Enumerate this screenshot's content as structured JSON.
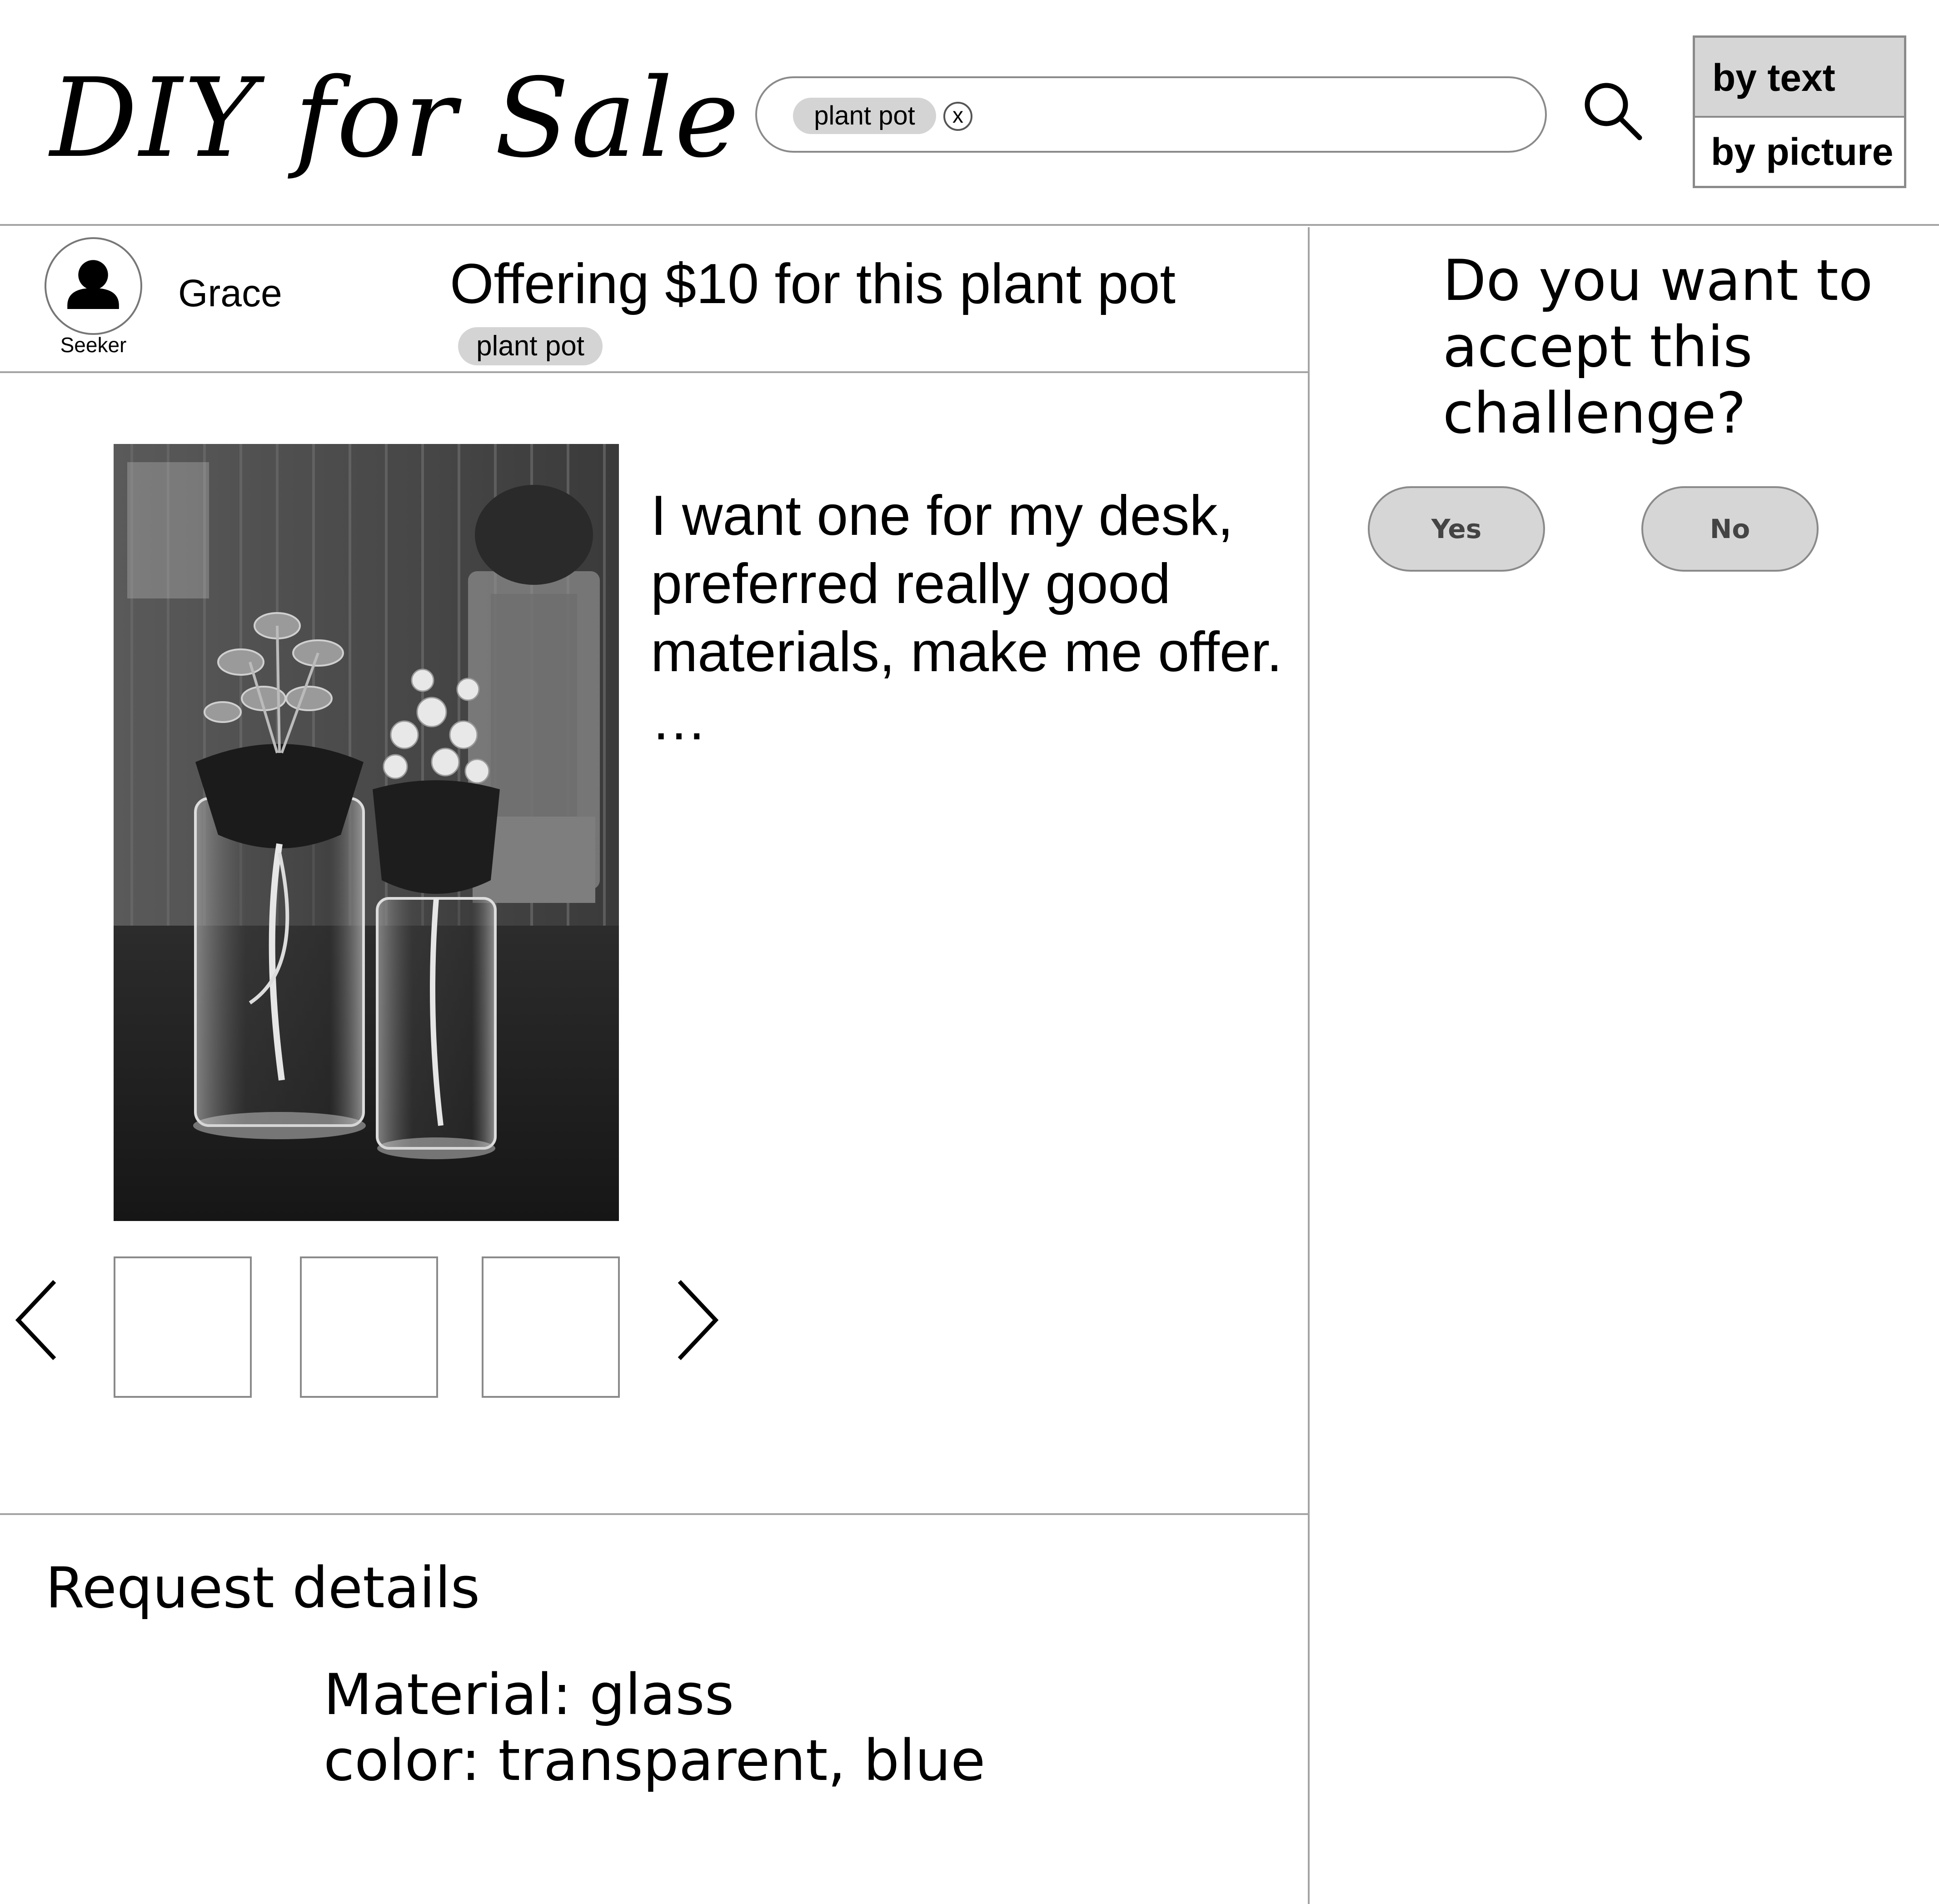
{
  "header": {
    "logo": "DIY for Sale",
    "search_chip": "plant pot",
    "search_chip_remove": "x",
    "search_mode": {
      "by_text": "by text",
      "by_picture": "by picture",
      "selected": "by text"
    }
  },
  "request": {
    "user_name": "Grace",
    "user_role": "Seeker",
    "title": "Offering $10 for this plant pot",
    "tag": "plant pot",
    "description": "I want one for my desk, preferred really good materials, make me offer.",
    "description_more": "…"
  },
  "details": {
    "title": "Request details",
    "lines": [
      "Material: glass",
      "color: transparent, blue"
    ]
  },
  "challenge": {
    "question": "Do you want to accept this challenge?",
    "yes_label": "Yes",
    "no_label": "No"
  },
  "icons": [
    "search-icon",
    "user-icon",
    "chevron-left-icon",
    "chevron-right-icon",
    "close-icon"
  ],
  "colors": {
    "divider": "#a4a4a4",
    "chip_bg": "#d4d4d4",
    "button_bg": "#d6d6d6"
  }
}
